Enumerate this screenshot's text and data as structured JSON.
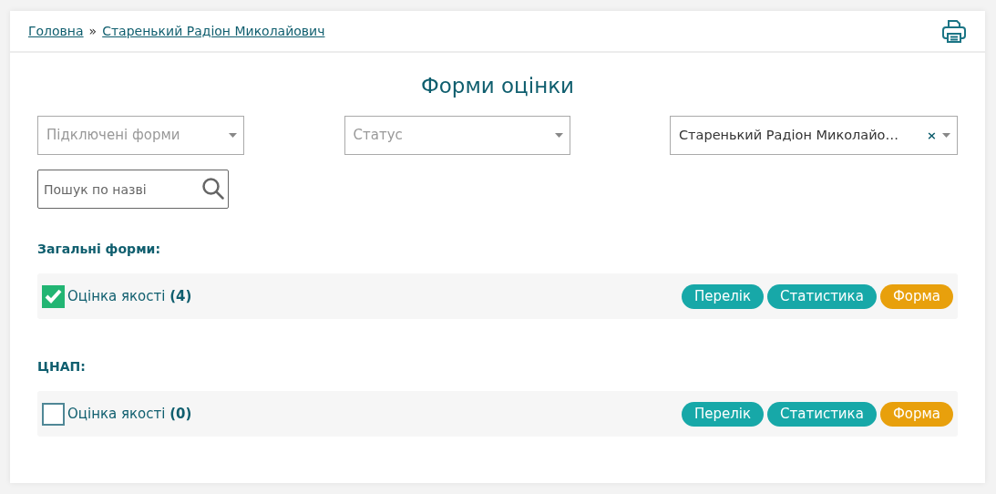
{
  "breadcrumbs": [
    {
      "label": "Головна"
    },
    {
      "label": "Старенький Радіон Миколайович"
    }
  ],
  "breadcrumb_separator": "»",
  "title": "Форми оцінки",
  "filters": [
    {
      "placeholder": "Підключені форми"
    },
    {
      "placeholder": "Статус"
    },
    {
      "value": "Старенький Радіон Миколайо…",
      "clear": "×"
    }
  ],
  "search": {
    "placeholder": "Пошук по назві"
  },
  "sections": [
    {
      "heading": "Загальні форми:",
      "items": [
        {
          "label": "Оцінка якості",
          "count": "(4)",
          "checked": true,
          "buttons": [
            {
              "label": "Перелік",
              "kind": "primary"
            },
            {
              "label": "Статистика",
              "kind": "primary"
            },
            {
              "label": "Форма",
              "kind": "accent"
            }
          ]
        }
      ]
    },
    {
      "heading": "ЦНАП:",
      "items": [
        {
          "label": "Оцінка якості",
          "count": "(0)",
          "checked": false,
          "buttons": [
            {
              "label": "Перелік",
              "kind": "primary"
            },
            {
              "label": "Статистика",
              "kind": "primary"
            },
            {
              "label": "Форма",
              "kind": "accent"
            }
          ]
        }
      ]
    }
  ]
}
